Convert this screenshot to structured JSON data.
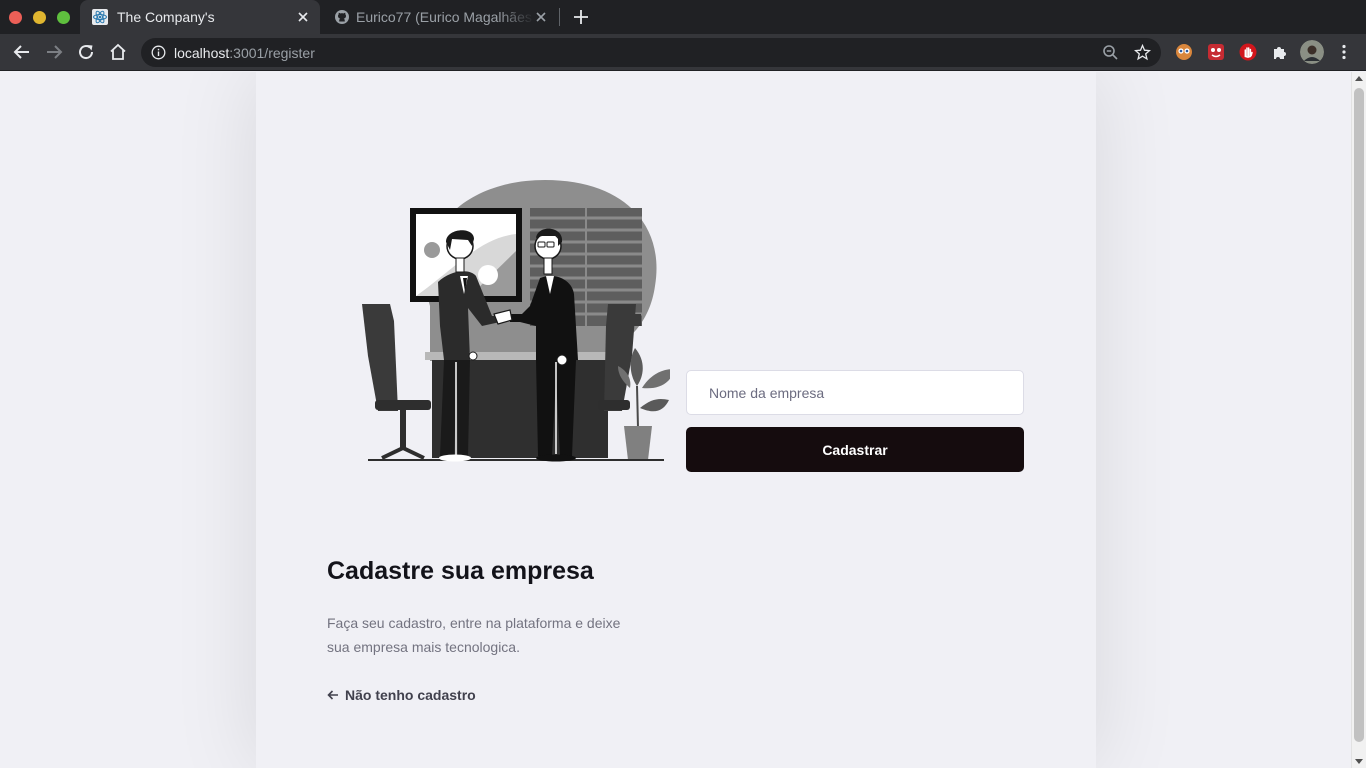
{
  "browser": {
    "active_tab": {
      "title": "The Company's",
      "favicon": "react-atom-icon"
    },
    "inactive_tab": {
      "title": "Eurico77 (Eurico Magalhães",
      "favicon": "github-icon"
    },
    "url": {
      "host": "localhost",
      "path": ":3001/register"
    },
    "extensions": [
      "sharingan-extension-icon",
      "red-extension-icon",
      "stop-hand-extension-icon",
      "puzzle-extensions-icon",
      "profile-avatar"
    ]
  },
  "illustration": {
    "name": "business-handshake-illustration"
  },
  "form": {
    "company_placeholder": "Nome da empresa",
    "submit_label": "Cadastrar"
  },
  "intro": {
    "heading": "Cadastre sua empresa",
    "description": "Faça seu cadastro, entre na plataforma e deixe sua empresa mais tecnologica.",
    "back_link": "Não tenho cadastro"
  },
  "colors": {
    "page_background": "#f0f0f5",
    "button_background": "#150c0e",
    "heading_text": "#13131a",
    "muted_text": "#737380"
  }
}
